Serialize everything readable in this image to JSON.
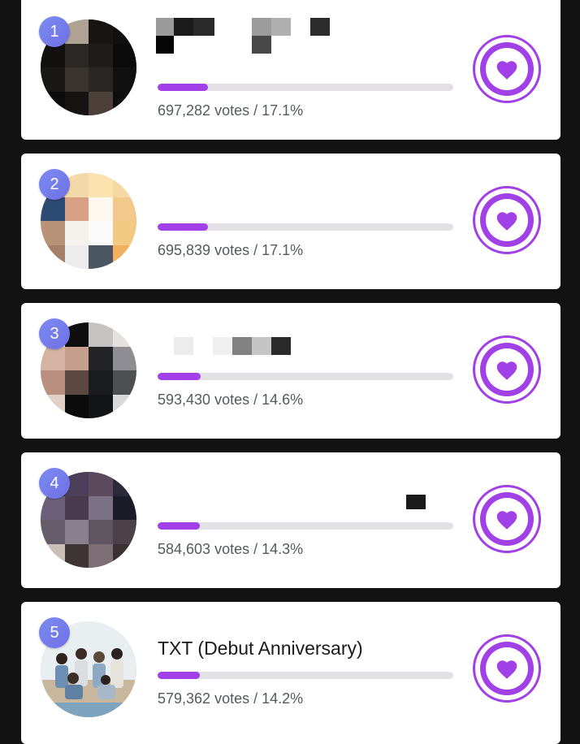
{
  "colors": {
    "accent": "#a040e6",
    "badge": "#7c8cf0",
    "track": "#e2e0e4",
    "background": "#121212"
  },
  "entries": [
    {
      "rank": "1",
      "name": "",
      "votes_text": "697,282 votes / 17.1%",
      "percent": 17.1,
      "avatar_icon": "avatar-image",
      "action_icon": "heart-icon"
    },
    {
      "rank": "2",
      "name": "",
      "votes_text": "695,839 votes / 17.1%",
      "percent": 17.1,
      "avatar_icon": "avatar-image",
      "action_icon": "heart-icon"
    },
    {
      "rank": "3",
      "name": "",
      "votes_text": "593,430 votes / 14.6%",
      "percent": 14.6,
      "avatar_icon": "avatar-image",
      "action_icon": "heart-icon"
    },
    {
      "rank": "4",
      "name": "",
      "votes_text": "584,603 votes / 14.3%",
      "percent": 14.3,
      "avatar_icon": "avatar-image",
      "action_icon": "heart-icon"
    },
    {
      "rank": "5",
      "name": "TXT (Debut Anniversary)",
      "votes_text": "579,362 votes / 14.2%",
      "percent": 14.2,
      "avatar_icon": "avatar-image",
      "action_icon": "heart-icon"
    }
  ]
}
